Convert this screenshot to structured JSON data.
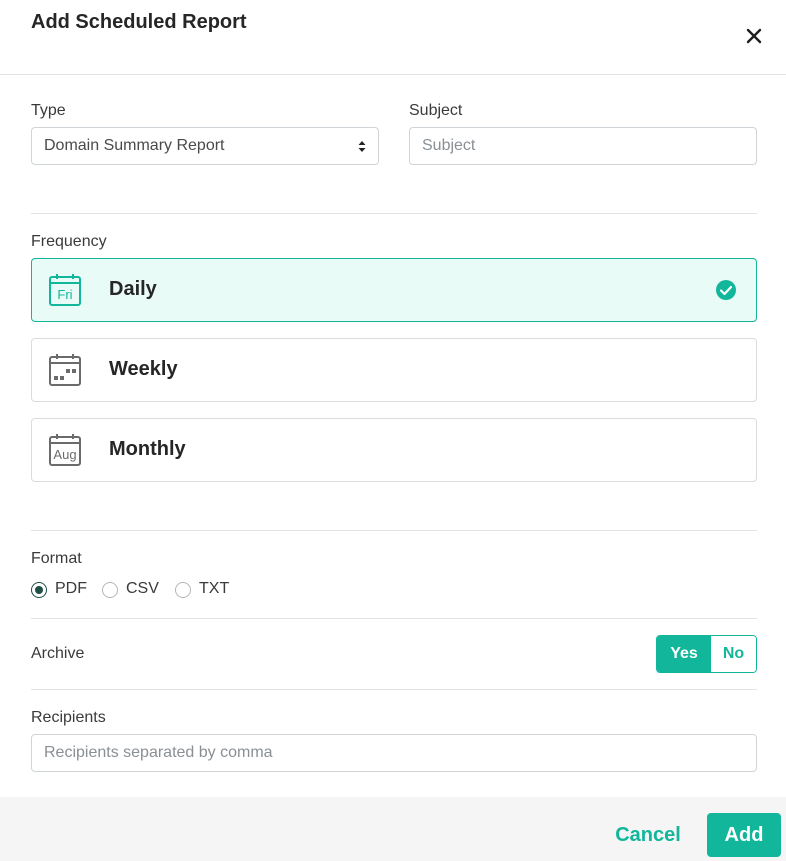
{
  "dialog": {
    "title": "Add Scheduled Report"
  },
  "type": {
    "label": "Type",
    "value": "Domain Summary Report"
  },
  "subject": {
    "label": "Subject",
    "placeholder": "Subject",
    "value": ""
  },
  "frequency": {
    "label": "Frequency",
    "options": [
      {
        "label": "Daily",
        "icon": "calendar-day-icon",
        "icon_text": "Fri",
        "selected": true
      },
      {
        "label": "Weekly",
        "icon": "calendar-week-icon",
        "selected": false
      },
      {
        "label": "Monthly",
        "icon": "calendar-month-icon",
        "icon_text": "Aug",
        "selected": false
      }
    ]
  },
  "format": {
    "label": "Format",
    "options": [
      {
        "label": "PDF",
        "selected": true
      },
      {
        "label": "CSV",
        "selected": false
      },
      {
        "label": "TXT",
        "selected": false
      }
    ]
  },
  "archive": {
    "label": "Archive",
    "yes_label": "Yes",
    "no_label": "No",
    "value": "Yes"
  },
  "recipients": {
    "label": "Recipients",
    "placeholder": "Recipients separated by comma",
    "value": ""
  },
  "footer": {
    "cancel_label": "Cancel",
    "add_label": "Add"
  },
  "colors": {
    "accent": "#12b79b",
    "selected_bg": "#e9fbf7",
    "radio_selected": "#1f4f47",
    "footer_bg": "#f5f5f5"
  }
}
